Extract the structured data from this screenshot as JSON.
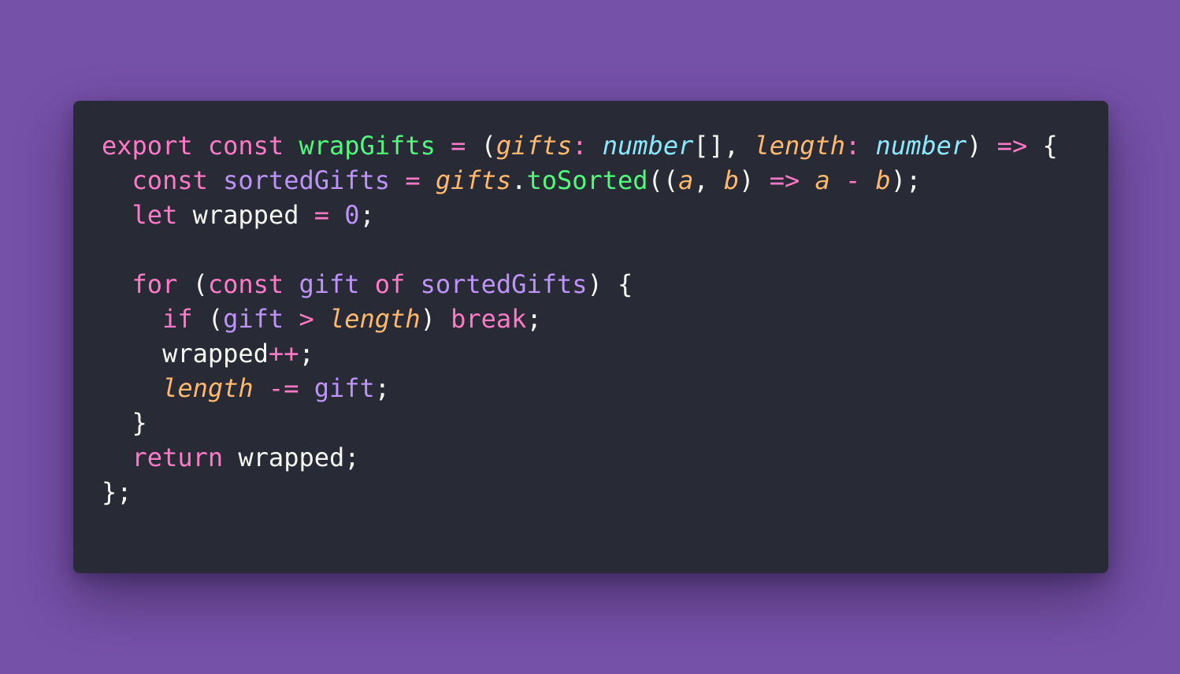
{
  "code": {
    "lines": [
      [
        {
          "text": "export",
          "cls": "k"
        },
        {
          "text": " ",
          "cls": "w"
        },
        {
          "text": "const",
          "cls": "k"
        },
        {
          "text": " ",
          "cls": "w"
        },
        {
          "text": "wrapGifts",
          "cls": "f"
        },
        {
          "text": " ",
          "cls": "w"
        },
        {
          "text": "=",
          "cls": "k"
        },
        {
          "text": " (",
          "cls": "w"
        },
        {
          "text": "gifts",
          "cls": "p"
        },
        {
          "text": ":",
          "cls": "k"
        },
        {
          "text": " ",
          "cls": "w"
        },
        {
          "text": "number",
          "cls": "t"
        },
        {
          "text": "[], ",
          "cls": "w"
        },
        {
          "text": "length",
          "cls": "p"
        },
        {
          "text": ":",
          "cls": "k"
        },
        {
          "text": " ",
          "cls": "w"
        },
        {
          "text": "number",
          "cls": "t"
        },
        {
          "text": ") ",
          "cls": "w"
        },
        {
          "text": "=>",
          "cls": "k"
        },
        {
          "text": " {",
          "cls": "w"
        }
      ],
      [
        {
          "text": "  ",
          "cls": "w"
        },
        {
          "text": "const",
          "cls": "k"
        },
        {
          "text": " ",
          "cls": "w"
        },
        {
          "text": "sortedGifts",
          "cls": "v"
        },
        {
          "text": " ",
          "cls": "w"
        },
        {
          "text": "=",
          "cls": "k"
        },
        {
          "text": " ",
          "cls": "w"
        },
        {
          "text": "gifts",
          "cls": "p"
        },
        {
          "text": ".",
          "cls": "w"
        },
        {
          "text": "toSorted",
          "cls": "f"
        },
        {
          "text": "((",
          "cls": "w"
        },
        {
          "text": "a",
          "cls": "p"
        },
        {
          "text": ", ",
          "cls": "w"
        },
        {
          "text": "b",
          "cls": "p"
        },
        {
          "text": ") ",
          "cls": "w"
        },
        {
          "text": "=>",
          "cls": "k"
        },
        {
          "text": " ",
          "cls": "w"
        },
        {
          "text": "a",
          "cls": "p"
        },
        {
          "text": " ",
          "cls": "w"
        },
        {
          "text": "-",
          "cls": "k"
        },
        {
          "text": " ",
          "cls": "w"
        },
        {
          "text": "b",
          "cls": "p"
        },
        {
          "text": ");",
          "cls": "w"
        }
      ],
      [
        {
          "text": "  ",
          "cls": "w"
        },
        {
          "text": "let",
          "cls": "k"
        },
        {
          "text": " wrapped ",
          "cls": "w"
        },
        {
          "text": "=",
          "cls": "k"
        },
        {
          "text": " ",
          "cls": "w"
        },
        {
          "text": "0",
          "cls": "v"
        },
        {
          "text": ";",
          "cls": "w"
        }
      ],
      [],
      [
        {
          "text": "  ",
          "cls": "w"
        },
        {
          "text": "for",
          "cls": "k"
        },
        {
          "text": " (",
          "cls": "w"
        },
        {
          "text": "const",
          "cls": "k"
        },
        {
          "text": " ",
          "cls": "w"
        },
        {
          "text": "gift",
          "cls": "v"
        },
        {
          "text": " ",
          "cls": "w"
        },
        {
          "text": "of",
          "cls": "k"
        },
        {
          "text": " ",
          "cls": "w"
        },
        {
          "text": "sortedGifts",
          "cls": "v"
        },
        {
          "text": ") {",
          "cls": "w"
        }
      ],
      [
        {
          "text": "    ",
          "cls": "w"
        },
        {
          "text": "if",
          "cls": "k"
        },
        {
          "text": " (",
          "cls": "w"
        },
        {
          "text": "gift",
          "cls": "v"
        },
        {
          "text": " ",
          "cls": "w"
        },
        {
          "text": ">",
          "cls": "k"
        },
        {
          "text": " ",
          "cls": "w"
        },
        {
          "text": "length",
          "cls": "p"
        },
        {
          "text": ") ",
          "cls": "w"
        },
        {
          "text": "break",
          "cls": "k"
        },
        {
          "text": ";",
          "cls": "w"
        }
      ],
      [
        {
          "text": "    wrapped",
          "cls": "w"
        },
        {
          "text": "++",
          "cls": "k"
        },
        {
          "text": ";",
          "cls": "w"
        }
      ],
      [
        {
          "text": "    ",
          "cls": "w"
        },
        {
          "text": "length",
          "cls": "p"
        },
        {
          "text": " ",
          "cls": "w"
        },
        {
          "text": "-=",
          "cls": "k"
        },
        {
          "text": " ",
          "cls": "w"
        },
        {
          "text": "gift",
          "cls": "v"
        },
        {
          "text": ";",
          "cls": "w"
        }
      ],
      [
        {
          "text": "  }",
          "cls": "w"
        }
      ],
      [
        {
          "text": "  ",
          "cls": "w"
        },
        {
          "text": "return",
          "cls": "k"
        },
        {
          "text": " wrapped;",
          "cls": "w"
        }
      ],
      [
        {
          "text": "};",
          "cls": "w"
        }
      ]
    ]
  },
  "colors": {
    "background": "#7651a8",
    "card": "#282a36",
    "keyword": "#ff79c6",
    "function": "#50fa7b",
    "parameter": "#ffb86c",
    "type": "#8be9fd",
    "variable": "#bd93f9",
    "text": "#f8f8f2"
  }
}
